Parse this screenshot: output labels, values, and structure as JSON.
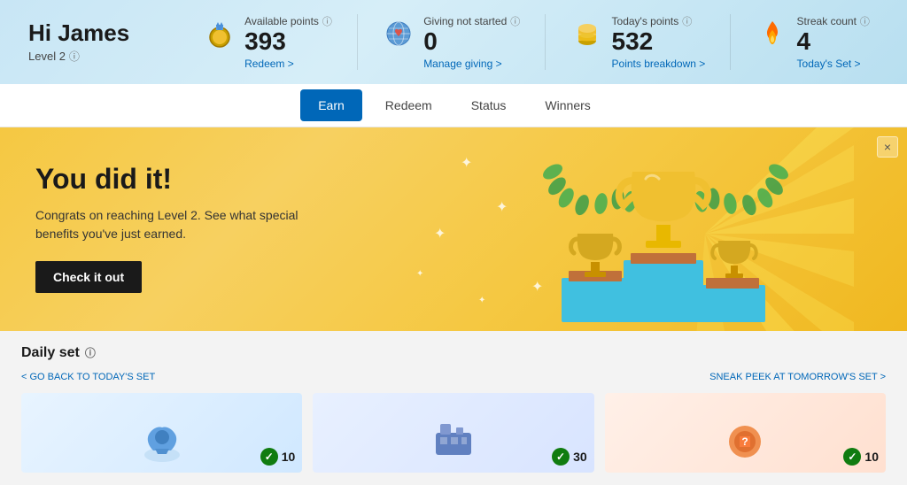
{
  "header": {
    "greeting": "Hi James",
    "level": "Level 2",
    "level_info_tooltip": "Level information",
    "stats": [
      {
        "id": "available-points",
        "label": "Available points",
        "value": "393",
        "link_text": "Redeem >",
        "icon": "medal"
      },
      {
        "id": "giving",
        "label": "Giving not started",
        "value": "0",
        "link_text": "Manage giving >",
        "icon": "globe"
      },
      {
        "id": "today-points",
        "label": "Today's points",
        "value": "532",
        "link_text": "Points breakdown >",
        "icon": "coins"
      },
      {
        "id": "streak",
        "label": "Streak count",
        "value": "4",
        "link_text": "Today's Set >",
        "icon": "flame"
      }
    ]
  },
  "nav": {
    "tabs": [
      {
        "id": "earn",
        "label": "Earn",
        "active": true
      },
      {
        "id": "redeem",
        "label": "Redeem",
        "active": false
      },
      {
        "id": "status",
        "label": "Status",
        "active": false
      },
      {
        "id": "winners",
        "label": "Winners",
        "active": false
      }
    ]
  },
  "banner": {
    "title": "You did it!",
    "description": "Congrats on reaching Level 2. See what special benefits you've just earned.",
    "button_label": "Check it out",
    "close_label": "×"
  },
  "daily_set": {
    "title": "Daily set",
    "info_tooltip": "Daily set information",
    "nav_back": "< GO BACK TO TODAY'S SET",
    "nav_forward": "SNEAK PEEK AT TOMORROW'S SET >",
    "cards": [
      {
        "id": "card-1",
        "points": 10,
        "completed": true
      },
      {
        "id": "card-2",
        "points": 30,
        "completed": true
      },
      {
        "id": "card-3",
        "points": 10,
        "completed": true
      }
    ]
  },
  "colors": {
    "accent_blue": "#0067b8",
    "banner_yellow": "#f5c842",
    "dark_bg": "#1a1a1a",
    "green": "#107c10"
  }
}
